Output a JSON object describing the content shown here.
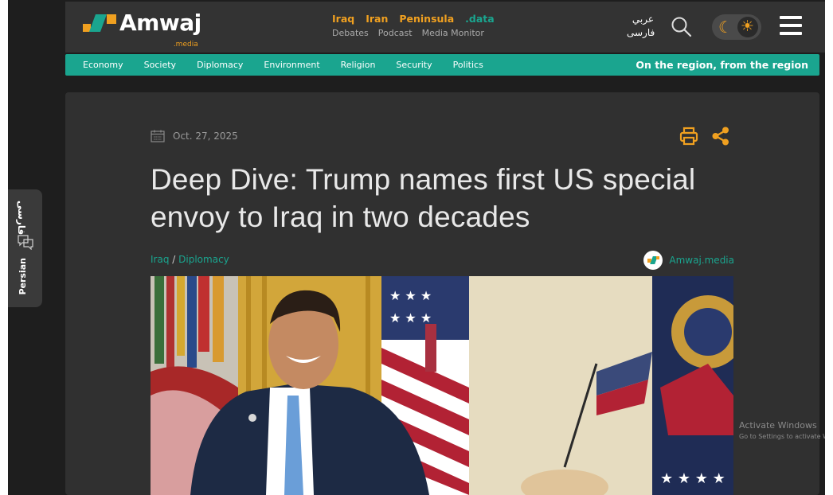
{
  "brand": {
    "name": "Amwaj",
    "sub": ".media"
  },
  "nav": {
    "primary": [
      "Iraq",
      "Iran",
      "Peninsula",
      ".data"
    ],
    "secondary": [
      "Debates",
      "Podcast",
      "Media Monitor"
    ],
    "lang_arabic": "عربي",
    "lang_persian": "فارسی"
  },
  "categories": [
    "Economy",
    "Society",
    "Diplomacy",
    "Environment",
    "Religion",
    "Security",
    "Politics"
  ],
  "slogan": "On the region, from the region",
  "article": {
    "date": "Oct. 27, 2025",
    "title": "Deep Dive: Trump names first US special envoy to Iraq in two decades",
    "crumb_1": "Iraq",
    "crumb_sep": "/",
    "crumb_2": "Diplomacy",
    "author": "Amwaj.media"
  },
  "side_tab": {
    "persian_script": "فارسی",
    "label": "Persian"
  },
  "watermark": {
    "line1": "Activate Windows",
    "line2": "Go to Settings to activate Windows."
  },
  "colors": {
    "accent_green": "#1aa58f",
    "accent_orange": "#f0a020",
    "bg_dark": "#1e1e1e",
    "card": "#303030"
  },
  "icons": [
    "calendar-icon",
    "print-icon",
    "share-icon",
    "search-icon",
    "moon-icon",
    "sun-icon",
    "menu-icon",
    "chat-icon"
  ]
}
